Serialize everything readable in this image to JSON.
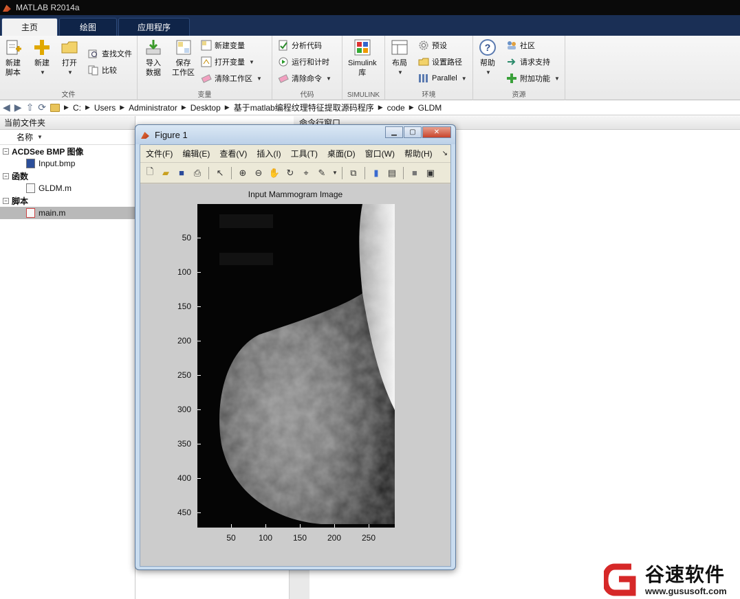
{
  "app": {
    "title": "MATLAB R2014a"
  },
  "tabs": [
    {
      "label": "主页"
    },
    {
      "label": "绘图"
    },
    {
      "label": "应用程序"
    }
  ],
  "ribbon": {
    "file": {
      "label": "文件",
      "new_script": "新建\n脚本",
      "new": "新建",
      "open": "打开",
      "find_files": "查找文件",
      "compare": "比较"
    },
    "variable": {
      "label": "变量",
      "import": "导入\n数据",
      "save_workspace": "保存\n工作区",
      "new_variable": "新建变量",
      "open_variable": "打开变量",
      "clear_workspace": "清除工作区"
    },
    "code": {
      "label": "代码",
      "analyze": "分析代码",
      "run_time": "运行和计时",
      "clear_commands": "清除命令"
    },
    "simulink": {
      "label": "SIMULINK",
      "library": "Simulink\n库"
    },
    "environment": {
      "label": "环境",
      "layout": "布局",
      "preferences": "预设",
      "set_path": "设置路径",
      "parallel": "Parallel"
    },
    "resources": {
      "label": "资源",
      "help": "帮助",
      "community": "社区",
      "request_support": "请求支持",
      "addons": "附加功能"
    }
  },
  "address": {
    "crumbs": [
      "C:",
      "Users",
      "Administrator",
      "Desktop",
      "基于matlab编程纹理特征提取源码程序",
      "code",
      "GLDM"
    ]
  },
  "current_folder": {
    "title": "当前文件夹",
    "name_header": "名称",
    "sections": [
      {
        "label": "ACDSee BMP 图像",
        "files": [
          "Input.bmp"
        ]
      },
      {
        "label": "函数",
        "files": [
          "GLDM.m"
        ]
      },
      {
        "label": "脚本",
        "files": [
          "main.m"
        ]
      }
    ]
  },
  "command_window": {
    "title": "命令行窗口"
  },
  "figure": {
    "title": "Figure 1",
    "menu": [
      "文件(F)",
      "编辑(E)",
      "查看(V)",
      "插入(I)",
      "工具(T)",
      "桌面(D)",
      "窗口(W)",
      "帮助(H)"
    ],
    "plot_title": "Input Mammogram Image",
    "yticks": [
      "50",
      "100",
      "150",
      "200",
      "250",
      "300",
      "350",
      "400",
      "450"
    ],
    "xticks": [
      "50",
      "100",
      "150",
      "200",
      "250"
    ]
  },
  "watermark": {
    "text": "谷速软件",
    "url": "www.gususoft.com"
  }
}
